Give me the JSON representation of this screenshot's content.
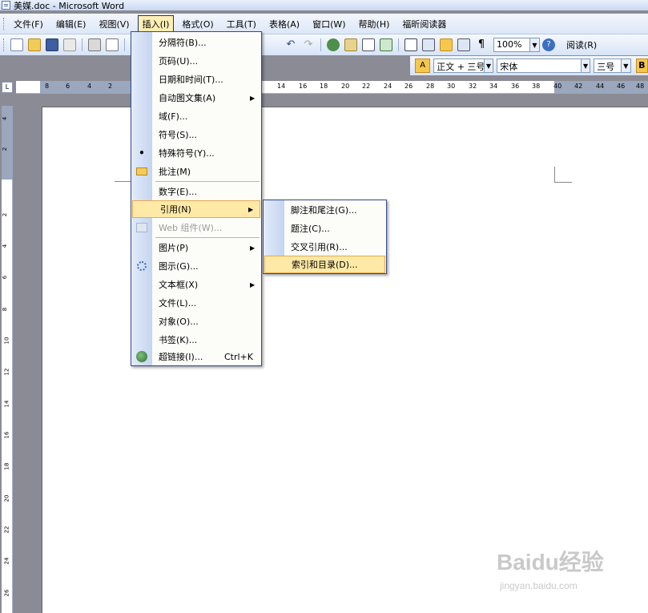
{
  "window": {
    "title": "美媒.doc - Microsoft Word"
  },
  "menubar": {
    "items": [
      {
        "label": "文件(F)"
      },
      {
        "label": "编辑(E)"
      },
      {
        "label": "视图(V)"
      },
      {
        "label": "插入(I)",
        "active": true
      },
      {
        "label": "格式(O)"
      },
      {
        "label": "工具(T)"
      },
      {
        "label": "表格(A)"
      },
      {
        "label": "窗口(W)"
      },
      {
        "label": "帮助(H)"
      },
      {
        "label": "福昕阅读器"
      }
    ]
  },
  "toolbar": {
    "zoom": "100%",
    "reading_label": "阅读(R)",
    "style": "正文 + 三号",
    "font": "宋体",
    "font_size": "三号",
    "bold": "B"
  },
  "ruler": {
    "corner": "L",
    "h_ticks": [
      "8",
      "6",
      "4",
      "2",
      "14",
      "16",
      "18",
      "20",
      "22",
      "24",
      "26",
      "28",
      "30",
      "32",
      "34",
      "36",
      "38",
      "40",
      "42",
      "44",
      "46",
      "48"
    ],
    "v_ticks": [
      "4",
      "2",
      "2",
      "4",
      "6",
      "8",
      "10",
      "12",
      "14",
      "16",
      "18",
      "20",
      "22",
      "24",
      "26"
    ]
  },
  "insert_menu": {
    "items": [
      {
        "label": "分隔符(B)..."
      },
      {
        "label": "页码(U)..."
      },
      {
        "label": "日期和时间(T)..."
      },
      {
        "label": "自动图文集(A)",
        "submenu": true
      },
      {
        "label": "域(F)..."
      },
      {
        "label": "符号(S)..."
      },
      {
        "label": "特殊符号(Y)..."
      },
      {
        "label": "批注(M)"
      },
      {
        "label": "数字(E)..."
      },
      {
        "label": "引用(N)",
        "submenu": true,
        "highlight": true
      },
      {
        "label": "Web 组件(W)...",
        "disabled": true
      },
      {
        "label": "图片(P)",
        "submenu": true
      },
      {
        "label": "图示(G)..."
      },
      {
        "label": "文本框(X)",
        "submenu": true
      },
      {
        "label": "文件(L)..."
      },
      {
        "label": "对象(O)..."
      },
      {
        "label": "书签(K)..."
      },
      {
        "label": "超链接(I)...",
        "shortcut": "Ctrl+K"
      }
    ]
  },
  "reference_submenu": {
    "items": [
      {
        "label": "脚注和尾注(G)..."
      },
      {
        "label": "题注(C)..."
      },
      {
        "label": "交叉引用(R)..."
      },
      {
        "label": "索引和目录(D)...",
        "highlight": true
      }
    ]
  },
  "watermark": {
    "logo": "Baidu经验",
    "url": "jingyan.baidu.com"
  },
  "colors": {
    "menu_highlight": "#ffe9a6",
    "menu_border": "#2f4d8c",
    "toolbar": "#dce7f8"
  }
}
